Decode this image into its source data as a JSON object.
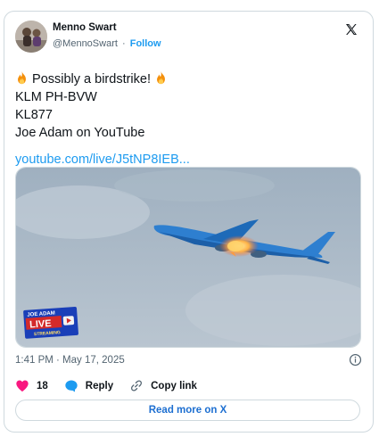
{
  "author": {
    "name": "Menno Swart",
    "handle": "@MennoSwart",
    "separator": "·",
    "follow_label": "Follow"
  },
  "platform_logo": "x-logo-icon",
  "tweet": {
    "line1": "Possibly a birdstrike!",
    "line2": "KLM PH-BVW",
    "line3": "KL877",
    "line4": "Joe Adam on YouTube",
    "link": "youtube.com/live/J5tNP8IEB..."
  },
  "media": {
    "badge_top": "JOE ADAM",
    "badge_main": "LIVE",
    "badge_bottom": "STREAMING"
  },
  "timestamp": "1:41 PM · May 17, 2025",
  "actions": {
    "like_count": "18",
    "reply_label": "Reply",
    "copy_link_label": "Copy link"
  },
  "read_more_label": "Read more on X",
  "colors": {
    "accent": "#1d9bf0",
    "like": "#f91880",
    "klm_blue": "#2e7fd0"
  }
}
